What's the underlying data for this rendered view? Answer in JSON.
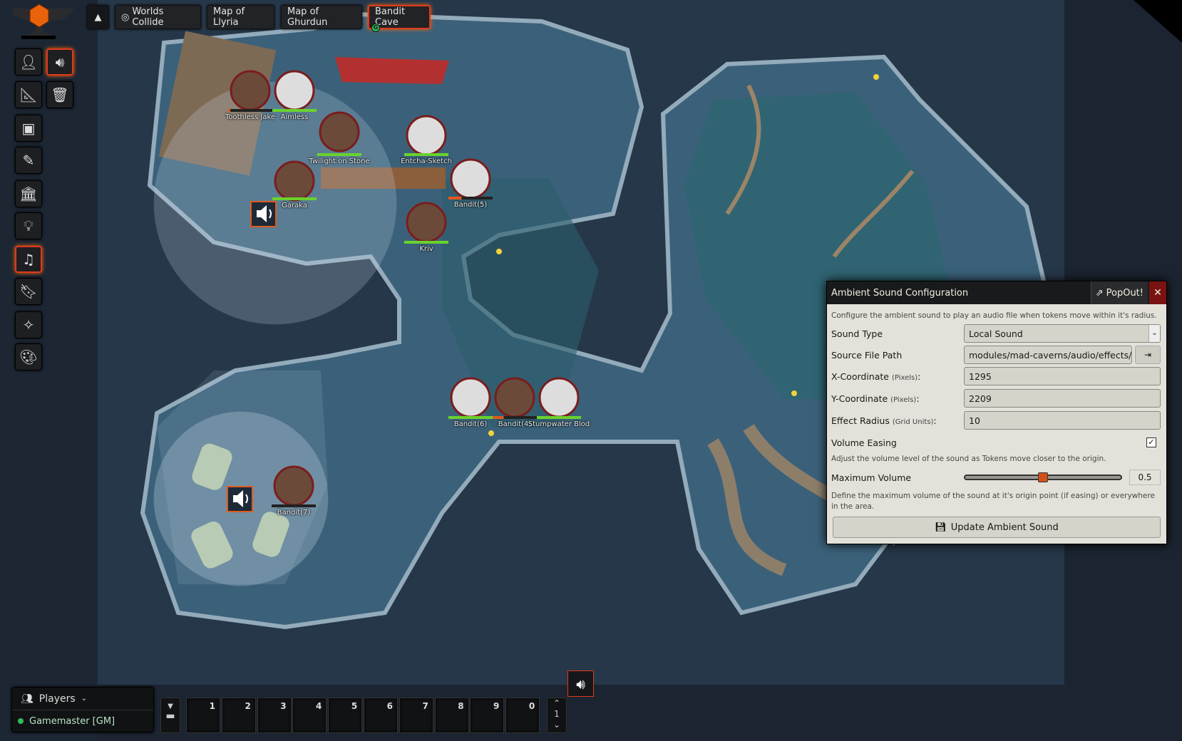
{
  "nav": {
    "collapse_icon": "caret-up-icon",
    "scenes": [
      {
        "label": "Worlds Collide",
        "icon": "target-icon"
      },
      {
        "label": "Map of Llyria"
      },
      {
        "label": "Map of Ghurdun"
      },
      {
        "label": "Bandit Cave",
        "active": true,
        "badge": "G"
      }
    ]
  },
  "controls": {
    "primary": [
      "token-icon",
      "ruler-icon",
      "tiles-icon",
      "pencil-icon",
      "walls-icon",
      "lightbulb-icon",
      "music-icon",
      "bookmark-icon",
      "magic-wand-icon",
      "palette-icon"
    ],
    "active_primary": "music-icon",
    "secondary": [
      "speaker-icon",
      "trash-icon"
    ],
    "active_secondary": "speaker-icon"
  },
  "tokens": [
    {
      "name": "Toothless Jake",
      "hp": 0.05
    },
    {
      "name": "Aimless",
      "hp": 1
    },
    {
      "name": "Twilight on Stone",
      "hp": 1
    },
    {
      "name": "Entcha-Sketch",
      "hp": 1
    },
    {
      "name": "Garaka",
      "hp": 1
    },
    {
      "name": "Bandit(5)",
      "hp": 0.3
    },
    {
      "name": "Kriv",
      "hp": 1
    },
    {
      "name": "Bandit(6)",
      "hp": 1
    },
    {
      "name": "Bandit(4)",
      "hp": 0.25
    },
    {
      "name": "Stumpwater Blod",
      "hp": 1
    },
    {
      "name": "Bandit(7)",
      "hp": 0
    }
  ],
  "dialog": {
    "title": "Ambient Sound Configuration",
    "popout": "PopOut!",
    "close_icon": "close-icon",
    "intro": "Configure the ambient sound to play an audio file when tokens move within it's radius.",
    "sound_type_label": "Sound Type",
    "sound_type_value": "Local Sound",
    "source_label": "Source File Path",
    "source_value": "modules/mad-caverns/audio/effects/F",
    "x_label": "X-Coordinate",
    "x_unit": "(Pixels)",
    "x_value": "1295",
    "y_label": "Y-Coordinate",
    "y_unit": "(Pixels)",
    "y_value": "2209",
    "radius_label": "Effect Radius",
    "radius_unit": "(Grid Units)",
    "radius_value": "10",
    "easing_label": "Volume Easing",
    "easing_checked": true,
    "easing_hint": "Adjust the volume level of the sound as Tokens move closer to the origin.",
    "volume_label": "Maximum Volume",
    "volume_value": "0.5",
    "volume_hint": "Define the maximum volume of the sound at it's origin point (if easing) or everywhere in the area.",
    "submit": "Update Ambient Sound"
  },
  "players": {
    "title": "Players",
    "list": [
      {
        "name": "Gamemaster [GM]",
        "status_color": "#2fbf5a"
      }
    ]
  },
  "hotbar": {
    "slots": [
      "1",
      "2",
      "3",
      "4",
      "5",
      "6",
      "7",
      "8",
      "9",
      "0"
    ],
    "page": "1"
  },
  "colors": {
    "accent": "#e0391d",
    "map_water": "#2d4a63"
  }
}
